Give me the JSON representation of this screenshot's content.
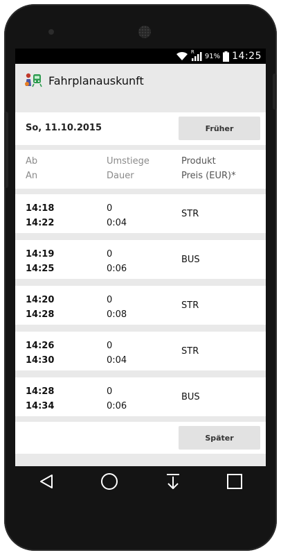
{
  "status": {
    "signal_badge": "R",
    "battery_percent": "91%",
    "time": "14:25"
  },
  "app": {
    "title": "Fahrplanauskunft",
    "icon": "train-app-icon"
  },
  "date_bar": {
    "date": "So, 11.10.2015",
    "earlier_label": "Früher"
  },
  "columns": {
    "depart": "Ab",
    "arrive": "An",
    "transfers": "Umstiege",
    "duration": "Dauer",
    "product": "Produkt",
    "price": "Preis (EUR)*"
  },
  "rows": [
    {
      "dep": "14:18",
      "arr": "14:22",
      "transfers": "0",
      "duration": "0:04",
      "product": "STR"
    },
    {
      "dep": "14:19",
      "arr": "14:25",
      "transfers": "0",
      "duration": "0:06",
      "product": "BUS"
    },
    {
      "dep": "14:20",
      "arr": "14:28",
      "transfers": "0",
      "duration": "0:08",
      "product": "STR"
    },
    {
      "dep": "14:26",
      "arr": "14:30",
      "transfers": "0",
      "duration": "0:04",
      "product": "STR"
    },
    {
      "dep": "14:28",
      "arr": "14:34",
      "transfers": "0",
      "duration": "0:06",
      "product": "BUS"
    }
  ],
  "footer": {
    "later_label": "Später"
  },
  "nav": {
    "icons": [
      "back-icon",
      "home-icon",
      "download-icon",
      "recents-icon"
    ]
  }
}
